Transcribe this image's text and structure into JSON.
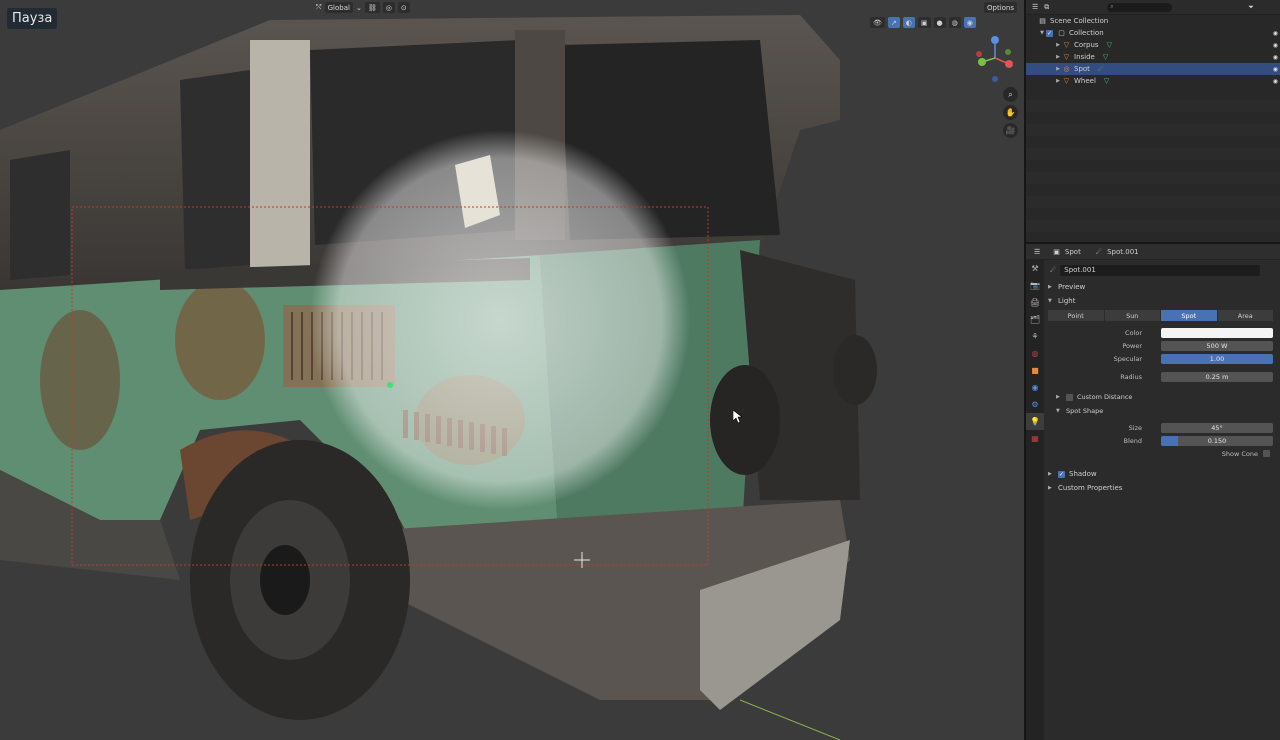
{
  "viewport": {
    "pause_label": "Пауза",
    "header": {
      "transform_orientation": "Global",
      "options_label": "Options"
    }
  },
  "outliner": {
    "rows": [
      {
        "label": "Scene Collection",
        "depth": 0,
        "icon": "scene-collection-icon",
        "selected": false
      },
      {
        "label": "Collection",
        "depth": 1,
        "icon": "collection-icon",
        "selected": false
      },
      {
        "label": "Corpus",
        "depth": 2,
        "icon": "object-icon",
        "selected": false
      },
      {
        "label": "Inside",
        "depth": 2,
        "icon": "object-icon",
        "selected": false
      },
      {
        "label": "Spot",
        "depth": 2,
        "icon": "light-icon",
        "selected": true
      },
      {
        "label": "Wheel",
        "depth": 2,
        "icon": "object-icon",
        "selected": false
      }
    ]
  },
  "properties": {
    "breadcrumb": {
      "object": "Spot",
      "data": "Spot.001"
    },
    "datablock_name": "Spot.001",
    "panels": {
      "preview": "Preview",
      "light": "Light",
      "shadow": "Shadow",
      "custom_properties": "Custom Properties"
    },
    "light_types": [
      "Point",
      "Sun",
      "Spot",
      "Area"
    ],
    "active_light_type": "Spot",
    "fields": {
      "color_label": "Color",
      "color_value": "#f4f4f4",
      "power_label": "Power",
      "power_value": "500 W",
      "specular_label": "Specular",
      "specular_value": "1.00",
      "radius_label": "Radius",
      "radius_value": "0.25 m"
    },
    "custom_distance_label": "Custom Distance",
    "spot_shape": {
      "title": "Spot Shape",
      "size_label": "Size",
      "size_value": "45°",
      "blend_label": "Blend",
      "blend_value": "0.150",
      "blend_fraction": 0.15,
      "show_cone_label": "Show Cone"
    }
  }
}
